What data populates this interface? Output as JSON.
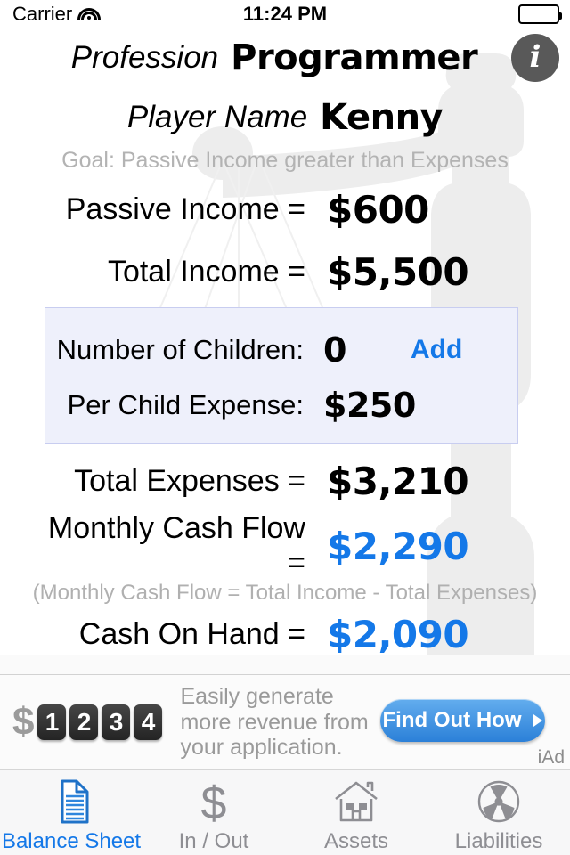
{
  "status_bar": {
    "carrier": "Carrier",
    "time": "11:24 PM",
    "wifi_icon": "wifi-icon",
    "battery_icon": "battery-full-icon"
  },
  "header": {
    "profession_label": "Profession",
    "profession_value": "Programmer",
    "player_label": "Player Name",
    "player_value": "Kenny",
    "info_button": "i",
    "goal_text": "Goal: Passive Income greater than Expenses"
  },
  "stats": {
    "passive_income_label": "Passive Income =",
    "passive_income_value": "$600",
    "total_income_label": "Total Income =",
    "total_income_value": "$5,500",
    "total_expenses_label": "Total Expenses =",
    "total_expenses_value": "$3,210",
    "monthly_cash_flow_label": "Monthly Cash Flow =",
    "monthly_cash_flow_value": "$2,290",
    "formula_note": "(Monthly Cash Flow = Total Income - Total Expenses)",
    "cash_on_hand_label": "Cash On Hand =",
    "cash_on_hand_value": "$2,090"
  },
  "children_box": {
    "number_label": "Number of Children:",
    "number_value": "0",
    "add_label": "Add",
    "per_child_label": "Per Child Expense:",
    "per_child_value": "$250"
  },
  "ad": {
    "logo_dollar": "$",
    "logo_digits": [
      "1",
      "2",
      "3",
      "4"
    ],
    "copy_line1": "Easily generate",
    "copy_line2": "more revenue from",
    "copy_line3": "your application.",
    "cta_label": "Find Out How",
    "tag": "iAd"
  },
  "tabs": [
    {
      "label": "Balance Sheet",
      "icon": "document-icon",
      "active": true
    },
    {
      "label": "In / Out",
      "icon": "dollar-sign-icon",
      "active": false
    },
    {
      "label": "Assets",
      "icon": "house-icon",
      "active": false
    },
    {
      "label": "Liabilities",
      "icon": "radiation-icon",
      "active": false
    }
  ],
  "colors": {
    "accent_blue": "#1478e8",
    "muted_gray": "#b3b3b3",
    "tab_inactive": "#8e8e93",
    "box_fill": "#eef0fb",
    "box_border": "#c8cdf0"
  }
}
